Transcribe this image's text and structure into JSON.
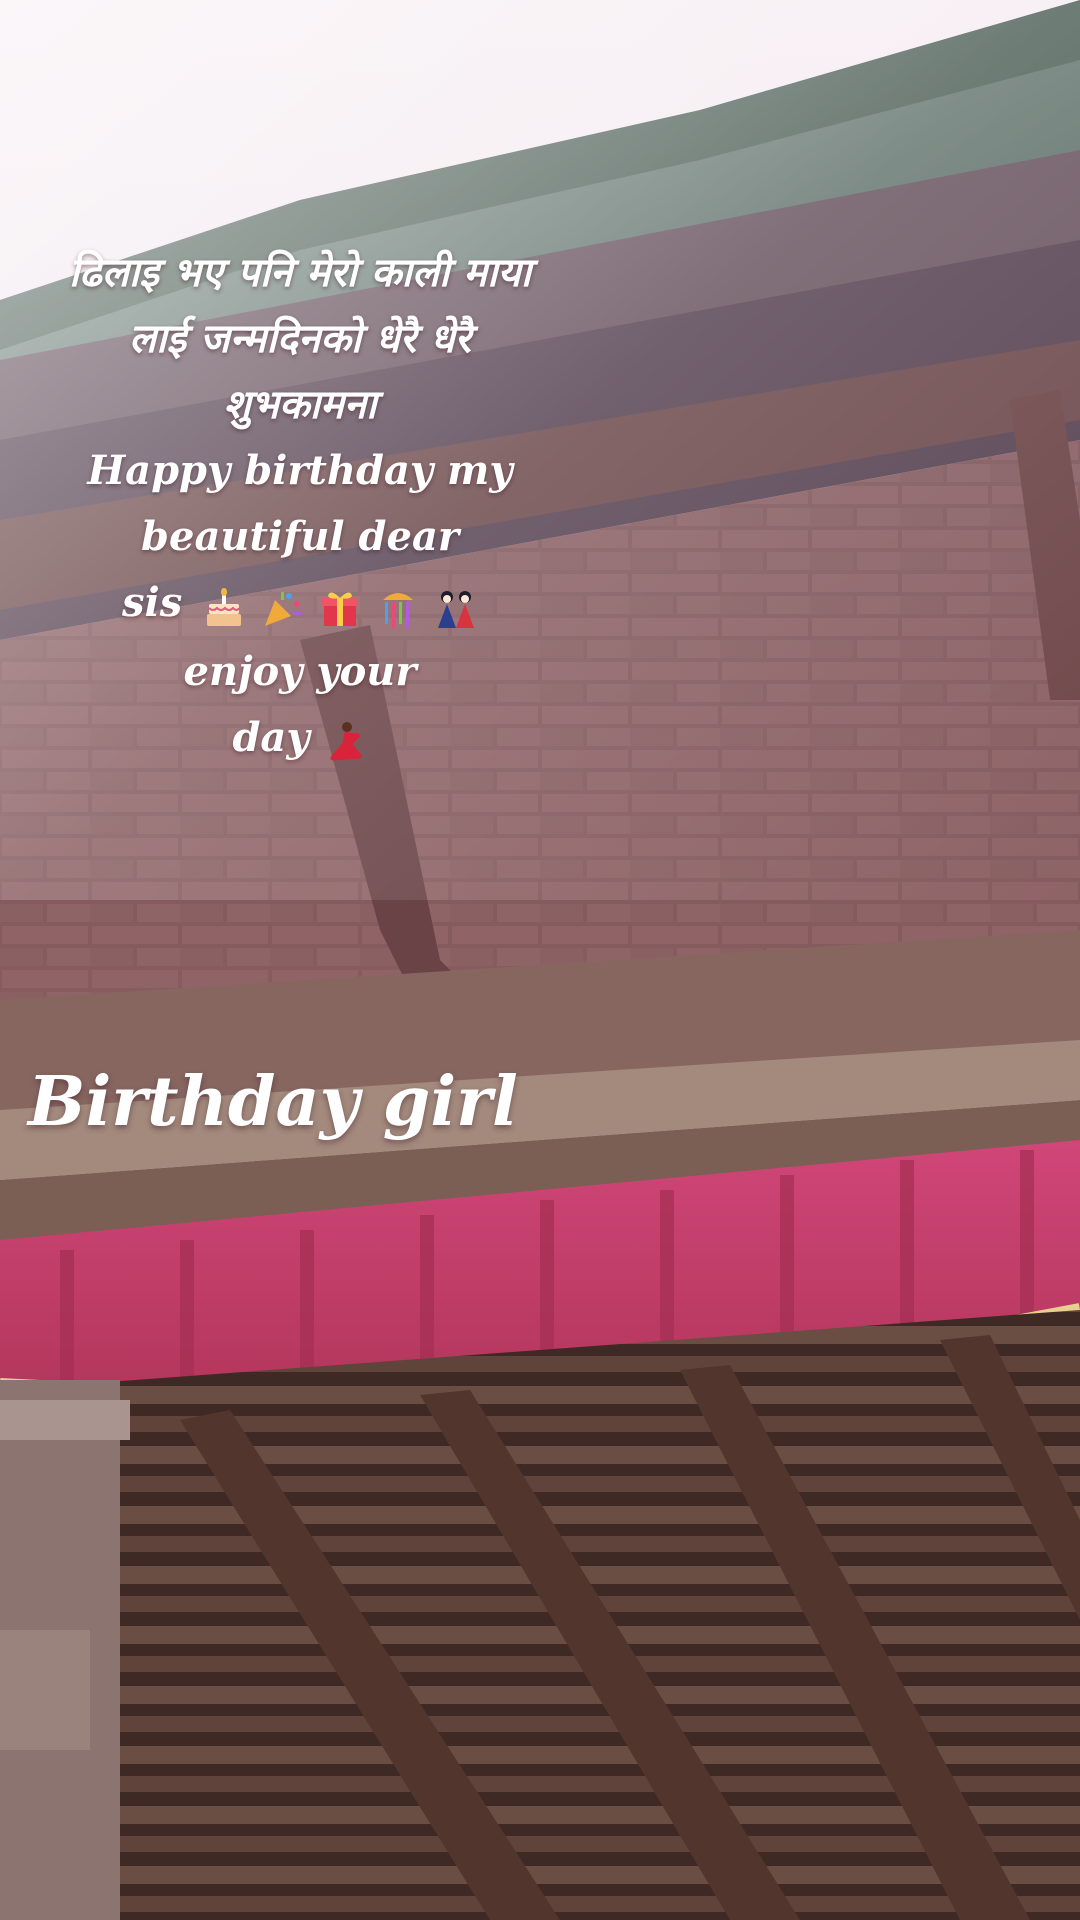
{
  "caption": {
    "lines": [
      "ढिलाइ भए पनि मेरो काली माया",
      "लाई जन्मदिनको धेरै धेरै",
      "शुभकामना",
      "Happy birthday my",
      "beautiful dear",
      "sis",
      "enjoy your",
      "day"
    ],
    "emojis": [
      "birthday-cake",
      "party-popper",
      "wrapped-gift",
      "confetti-ball",
      "couple-dolls",
      "dancer"
    ]
  },
  "headline": "Birthday girl",
  "colors": {
    "sky": "#f1e6ec",
    "roof_green": "#5d7168",
    "brick": "#8a5d5d",
    "wood": "#5a3c33",
    "cloth_red": "#c43a66",
    "gold_trim": "#e8cf8e",
    "text": "#ffffff"
  }
}
